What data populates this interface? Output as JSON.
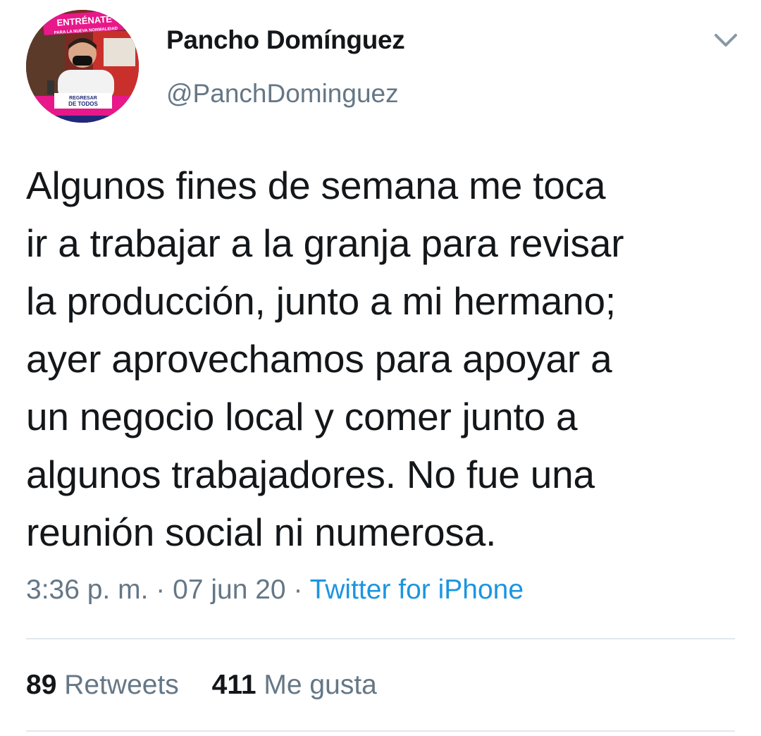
{
  "user": {
    "display_name": "Pancho Domínguez",
    "handle": "@PanchDominguez",
    "avatar": {
      "banner_top_title": "ENTRÉNATE",
      "banner_top_subtitle": "PARA LA NUEVA NORMALIDAD",
      "banner_bottom_line1": "REGRESAR",
      "banner_bottom_line2": "DE TODOS"
    }
  },
  "tweet": {
    "text_lines": [
      "Algunos fines de semana me toca",
      "ir a trabajar a la granja para revisar",
      "la producción, junto a mi hermano;",
      "ayer aprovechamos para apoyar a",
      "un negocio local y comer junto a",
      "algunos trabajadores. No fue una",
      "reunión social ni numerosa."
    ],
    "time": "3:36 p. m.",
    "separator": "·",
    "date": "07 jun 20",
    "source": "Twitter for iPhone"
  },
  "stats": {
    "retweets_count": "89",
    "retweets_label": "Retweets",
    "likes_count": "411",
    "likes_label": "Me gusta"
  },
  "icons": {
    "menu": "chevron-down-icon"
  },
  "colors": {
    "text_primary": "#14171a",
    "text_secondary": "#657786",
    "link": "#1b95e0",
    "divider": "#e1e8ed",
    "avatar_banner_pink": "#e8188a"
  }
}
